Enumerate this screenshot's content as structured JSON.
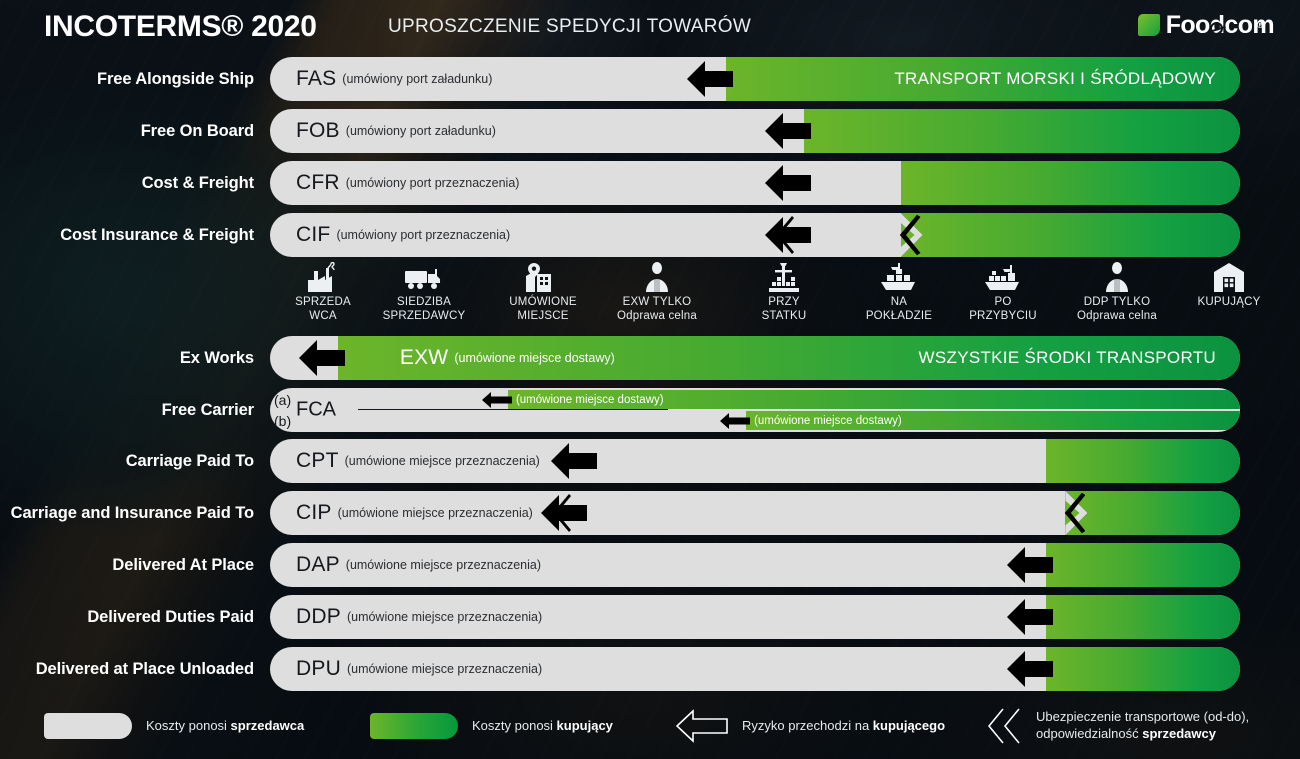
{
  "header": {
    "title_main": "INCOTERMS® 2020",
    "title_sub": "UPROSZCZENIE SPEDYCJI TOWARÓW",
    "brand": "Foodcom",
    "brand_reg": "®"
  },
  "colors": {
    "seller_cost": "#dedede",
    "buyer_cost_light": "#6cb52a",
    "buyer_cost_dark": "#0b9240",
    "risk_arrow": "#000000",
    "background": "#080e14",
    "text_light": "#ffffff"
  },
  "groups": [
    {
      "id": "sea",
      "mode_label": "TRANSPORT MORSKI I ŚRÓDLĄDOWY"
    },
    {
      "id": "any",
      "mode_label": "WSZYSTKIE ŚRODKI TRANSPORTU"
    }
  ],
  "rows": [
    {
      "label": "Free Alongside Ship",
      "code": "FAS",
      "place": "(umówiony port załadunku)",
      "seller_pct": 47,
      "risk_pct": 47,
      "green_end_pct": 100,
      "insurance": false,
      "mode_label": "TRANSPORT MORSKI I ŚRÓDLĄDOWY",
      "light_text": false
    },
    {
      "label": "Free On Board",
      "code": "FOB",
      "place": "(umówiony port załadunku)",
      "seller_pct": 55,
      "risk_pct": 55,
      "green_end_pct": 100,
      "insurance": false,
      "mode_label": "",
      "light_text": false
    },
    {
      "label": "Cost & Freight",
      "code": "CFR",
      "place": "(umówiony port przeznaczenia)",
      "seller_pct": 65,
      "risk_pct": 55,
      "green_end_pct": 100,
      "insurance": false,
      "mode_label": "",
      "light_text": false
    },
    {
      "label": "Cost Insurance & Freight",
      "code": "CIF",
      "place": "(umówiony port przeznaczenia)",
      "seller_pct": 65,
      "risk_pct": 55,
      "green_end_pct": 100,
      "insurance": true,
      "insurance_from_pct": 52,
      "insurance_to_pct": 65,
      "mode_label": "",
      "light_text": false
    },
    {
      "label": "Ex Works",
      "code": "EXW",
      "place": "(umówione miejsce dostawy)",
      "seller_pct": 7,
      "risk_pct": 7,
      "green_end_pct": 100,
      "insurance": false,
      "mode_label": "WSZYSTKIE ŚRODKI TRANSPORTU",
      "light_text": true
    },
    {
      "label": "Carriage Paid To",
      "code": "CPT",
      "place": "(umówione miejsce przeznaczenia)",
      "seller_pct": 80,
      "risk_pct": 33,
      "green_end_pct": 100,
      "insurance": false,
      "mode_label": "",
      "light_text": false
    },
    {
      "label": "Carriage and Insurance Paid To",
      "code": "CIP",
      "place": "(umówione miejsce przeznaczenia)",
      "seller_pct": 82,
      "risk_pct": 32,
      "green_end_pct": 100,
      "insurance": true,
      "insurance_from_pct": 29,
      "insurance_to_pct": 82,
      "mode_label": "",
      "light_text": false
    },
    {
      "label": "Delivered At Place",
      "code": "DAP",
      "place": "(umówione miejsce przeznaczenia)",
      "seller_pct": 80,
      "risk_pct": 80,
      "green_end_pct": 100,
      "insurance": false,
      "mode_label": "",
      "light_text": false
    },
    {
      "label": "Delivered Duties Paid",
      "code": "DDP",
      "place": "(umówione miejsce przeznaczenia)",
      "seller_pct": 80,
      "risk_pct": 80,
      "green_end_pct": 100,
      "insurance": false,
      "mode_label": "",
      "light_text": false
    },
    {
      "label": "Delivered at Place Unloaded",
      "code": "DPU",
      "place": "(umówione miejsce przeznaczenia)",
      "seller_pct": 80,
      "risk_pct": 80,
      "green_end_pct": 100,
      "insurance": false,
      "mode_label": "",
      "light_text": false
    }
  ],
  "fca": {
    "label": "Free Carrier",
    "code": "FCA",
    "variants": [
      {
        "tag": "(a)",
        "place": "(umówione miejsce dostawy)",
        "seller_pct": 17,
        "risk_pct": 17
      },
      {
        "tag": "(b)",
        "place": "(umówione miejsce dostawy)",
        "seller_pct": 44,
        "risk_pct": 44
      }
    ]
  },
  "milestones": [
    {
      "icon": "factory-icon",
      "caption": "SPRZEDA\nWCA",
      "sub": ""
    },
    {
      "icon": "truck-icon",
      "caption": "SIEDZIBA\nSPRZEDAWCY",
      "sub": ""
    },
    {
      "icon": "place-pin-icon",
      "caption": "UMÓWIONE\nMIEJSCE",
      "sub": ""
    },
    {
      "icon": "person-icon",
      "caption": "EXW TYLKO",
      "sub": "Odprawa celna"
    },
    {
      "icon": "port-crane-icon",
      "caption": "PRZY\nSTATKU",
      "sub": ""
    },
    {
      "icon": "ship-loaded-icon",
      "caption": "NA\nPOKŁADZIE",
      "sub": ""
    },
    {
      "icon": "ship-arrived-icon",
      "caption": "PO\nPRZYBYCIU",
      "sub": ""
    },
    {
      "icon": "person-icon",
      "caption": "DDP TYLKO",
      "sub": "Odprawa celna"
    },
    {
      "icon": "warehouse-icon",
      "caption": "KUPUJĄCY",
      "sub": ""
    }
  ],
  "legend": [
    {
      "kind": "swatch-gray",
      "text_plain": "Koszty ponosi ",
      "text_bold": "sprzedawca",
      "text_tail": ""
    },
    {
      "kind": "swatch-green",
      "text_plain": "Koszty ponosi ",
      "text_bold": "kupujący",
      "text_tail": ""
    },
    {
      "kind": "arrow-outline",
      "text_plain": "Ryzyko przechodzi na ",
      "text_bold": "kupującego",
      "text_tail": ""
    },
    {
      "kind": "chevron-outline",
      "text_plain": "Ubezpieczenie transportowe (od-do), odpowiedzialność ",
      "text_bold": "sprzedawcy",
      "text_tail": ""
    }
  ]
}
